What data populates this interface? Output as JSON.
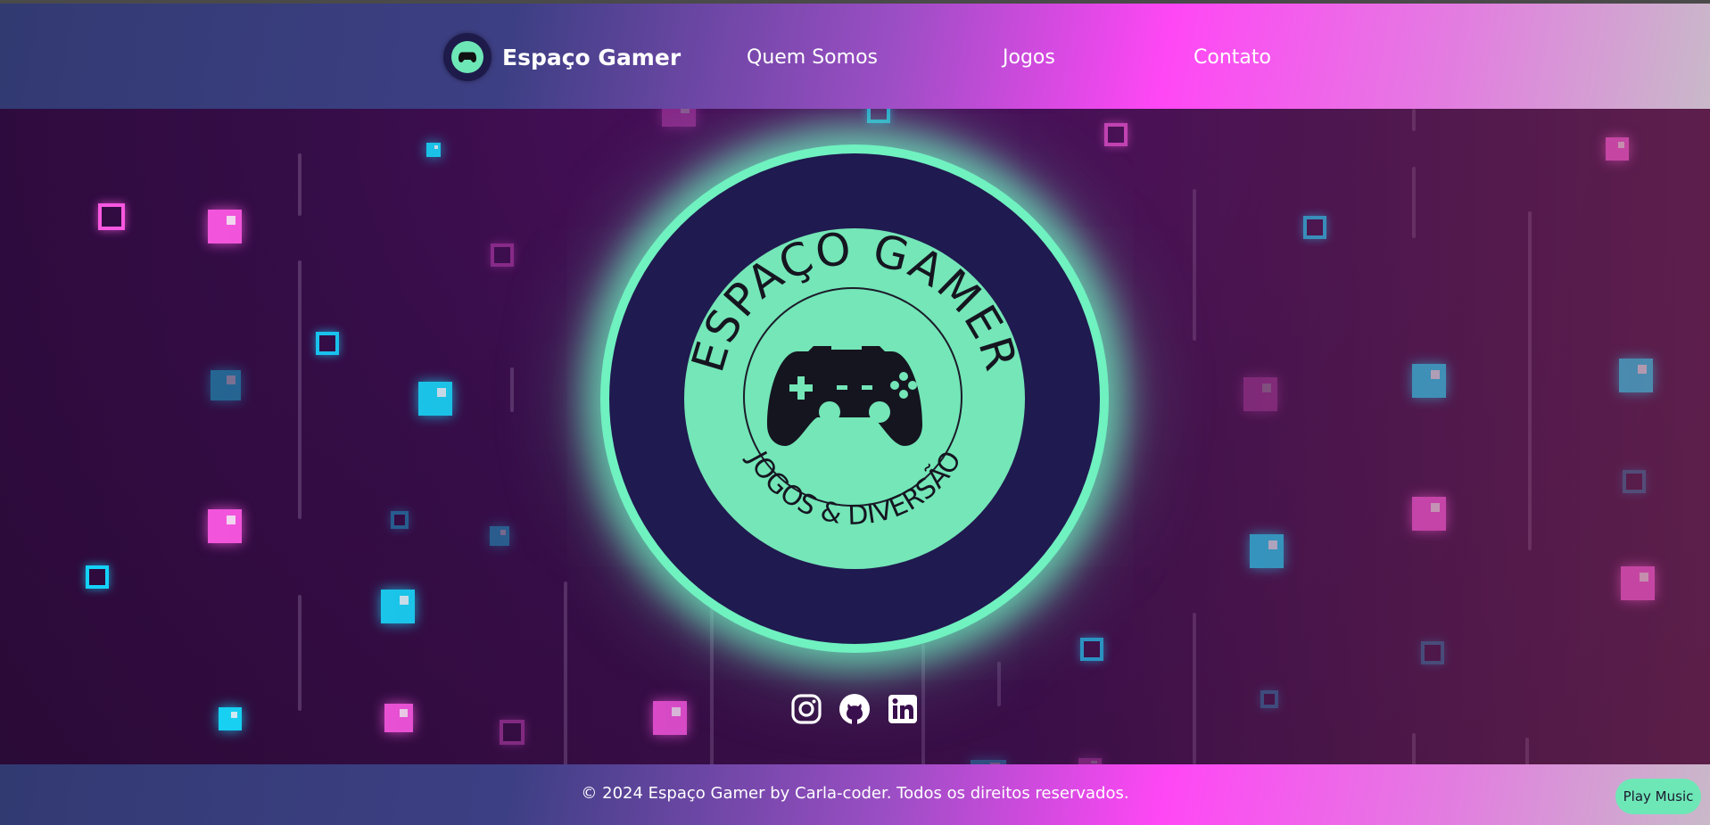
{
  "header": {
    "brand_name": "Espaço Gamer",
    "nav": [
      {
        "label": "Quem Somos"
      },
      {
        "label": "Jogos"
      },
      {
        "label": "Contato"
      }
    ]
  },
  "hero_logo": {
    "top_text": "ESPAÇO GAMER",
    "bottom_text": "JOGOS & DIVERSÃO",
    "icon": "gamepad-icon"
  },
  "social_links": [
    {
      "icon": "instagram-icon"
    },
    {
      "icon": "github-icon"
    },
    {
      "icon": "linkedin-icon"
    }
  ],
  "footer": {
    "copyright": "© 2024 Espaço Gamer by Carla-coder. Todos os direitos reservados.",
    "music_button": "Play Music"
  },
  "colors": {
    "accent_mint": "#6ee7b7",
    "neon_pink": "#ff5ae6",
    "neon_cyan": "#12e0ff",
    "logo_navy": "#1f1a4f"
  }
}
